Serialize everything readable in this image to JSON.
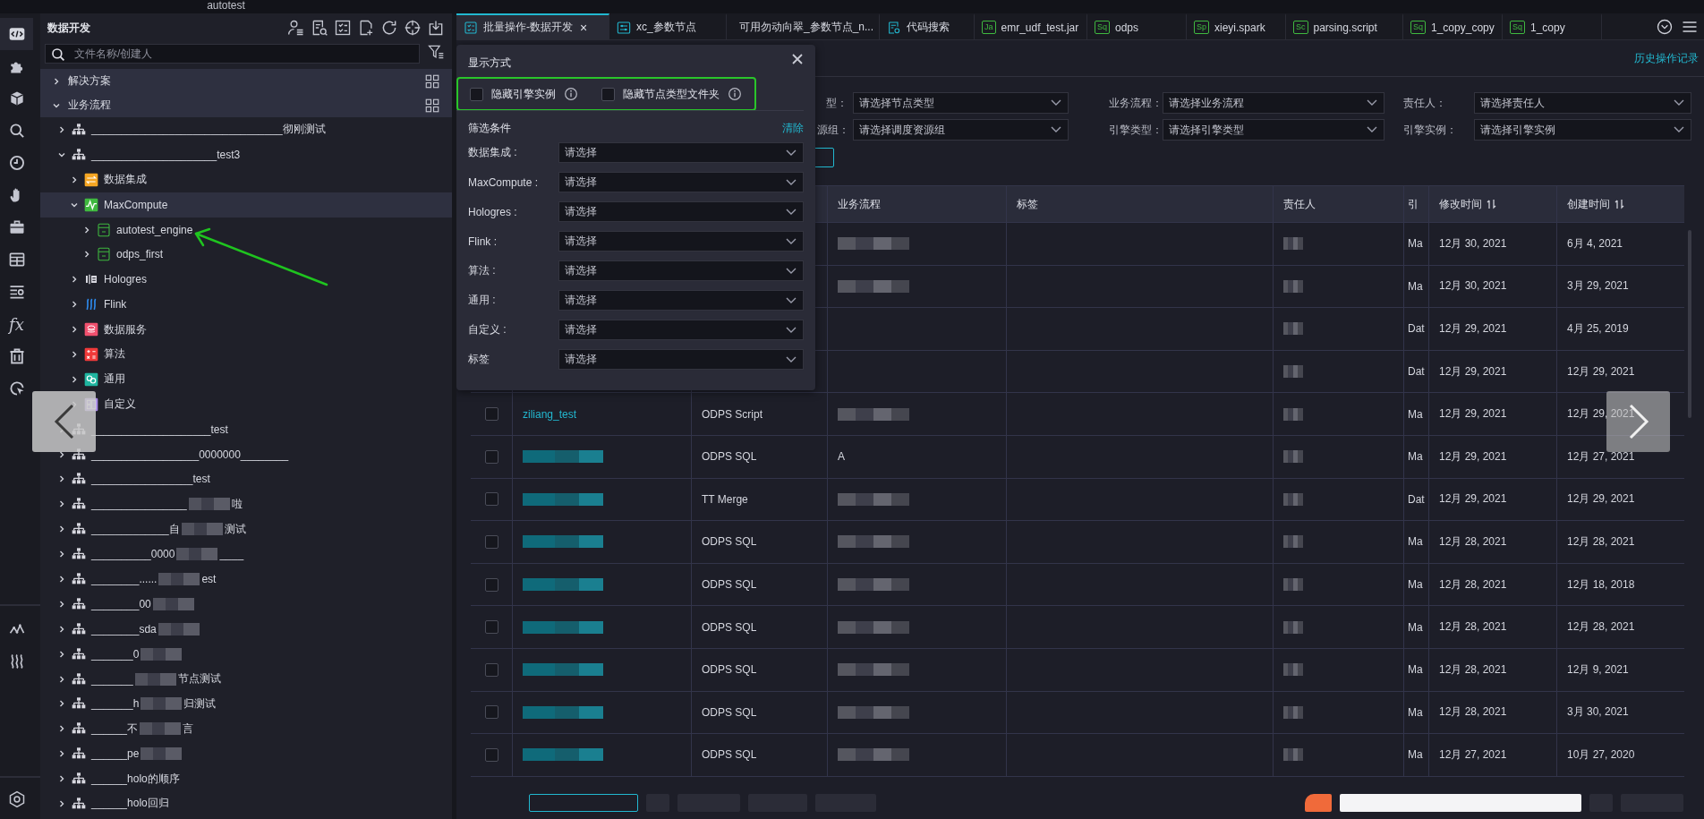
{
  "window": {
    "title": "autotest"
  },
  "rail": {
    "items": [
      {
        "kind": "code",
        "selected": true
      },
      {
        "kind": "puzzle",
        "selected": false
      },
      {
        "kind": "cube",
        "selected": false
      },
      {
        "kind": "search",
        "selected": false
      },
      {
        "kind": "clock",
        "selected": false
      },
      {
        "kind": "hand",
        "selected": false
      },
      {
        "kind": "toolbox",
        "selected": false
      },
      {
        "kind": "table",
        "selected": false
      },
      {
        "kind": "list",
        "selected": false
      },
      {
        "kind": "glyph",
        "text": "fx",
        "selected": false
      },
      {
        "kind": "trash",
        "selected": false
      },
      {
        "kind": "cursor",
        "selected": false
      },
      {
        "kind": "linechart",
        "selected": false
      },
      {
        "kind": "waves",
        "selected": false
      },
      {
        "kind": "settings",
        "selected": false
      }
    ]
  },
  "sidebar": {
    "title": "数据开发",
    "search": {
      "placeholder": "文件名称/创建人"
    },
    "sections": [
      {
        "label": "解决方案",
        "expanded": false
      },
      {
        "label": "业务流程",
        "expanded": true,
        "children": [
          {
            "kind": "workflow",
            "label": "________________________________彻刚测试",
            "expanded": false,
            "selected": false
          },
          {
            "kind": "workflow",
            "label": "_____________________test3",
            "expanded": true,
            "selected": false,
            "children": [
              {
                "kind": "integration",
                "label": "数据集成",
                "expanded": false,
                "selected": false
              },
              {
                "kind": "maxcompute",
                "label": "MaxCompute",
                "expanded": true,
                "selected": true,
                "children": [
                  {
                    "kind": "engine",
                    "label": "autotest_engine",
                    "expanded": false,
                    "selected": false
                  },
                  {
                    "kind": "engine",
                    "label": "odps_first",
                    "expanded": false,
                    "selected": false
                  }
                ]
              },
              {
                "kind": "hologres",
                "label": "Hologres",
                "expanded": false,
                "selected": false
              },
              {
                "kind": "flink",
                "label": "Flink",
                "expanded": false,
                "selected": false
              },
              {
                "kind": "dataservice",
                "label": "数据服务",
                "expanded": false,
                "selected": false
              },
              {
                "kind": "algorithm",
                "label": "算法",
                "expanded": false,
                "selected": false
              },
              {
                "kind": "general",
                "label": "通用",
                "expanded": false,
                "selected": false
              },
              {
                "kind": "custom",
                "label": "自定义",
                "expanded": false,
                "selected": false
              }
            ]
          },
          {
            "kind": "workflow",
            "label": "____________________test",
            "expanded": false,
            "selected": false
          },
          {
            "kind": "workflow",
            "label": "__________________0000000________",
            "expanded": false,
            "selected": false
          },
          {
            "kind": "workflow",
            "label": "_________________test",
            "expanded": false,
            "selected": false
          },
          {
            "kind": "workflow",
            "parts": [
              {
                "text": "________________"
              },
              {
                "kind": "redacted"
              },
              {
                "text": "啦"
              }
            ],
            "expanded": false,
            "selected": false
          },
          {
            "kind": "workflow",
            "parts": [
              {
                "text": "_____________自"
              },
              {
                "kind": "redacted"
              },
              {
                "text": "测试"
              }
            ],
            "expanded": false,
            "selected": false
          },
          {
            "kind": "workflow",
            "parts": [
              {
                "text": "__________0000"
              },
              {
                "kind": "redacted"
              },
              {
                "text": "____"
              }
            ],
            "expanded": false,
            "selected": false
          },
          {
            "kind": "workflow",
            "parts": [
              {
                "text": "________......"
              },
              {
                "kind": "redacted"
              },
              {
                "text": "est"
              }
            ],
            "expanded": false,
            "selected": false
          },
          {
            "kind": "workflow",
            "parts": [
              {
                "text": "________00"
              },
              {
                "kind": "redacted"
              }
            ],
            "expanded": false,
            "selected": false
          },
          {
            "kind": "workflow",
            "parts": [
              {
                "text": "________sda"
              },
              {
                "kind": "redacted"
              }
            ],
            "expanded": false,
            "selected": false
          },
          {
            "kind": "workflow",
            "parts": [
              {
                "text": "_______0"
              },
              {
                "kind": "redacted"
              }
            ],
            "expanded": false,
            "selected": false
          },
          {
            "kind": "workflow",
            "parts": [
              {
                "text": "_______"
              },
              {
                "kind": "redacted"
              },
              {
                "text": "节点测试"
              }
            ],
            "expanded": false,
            "selected": false
          },
          {
            "kind": "workflow",
            "parts": [
              {
                "text": "_______h"
              },
              {
                "kind": "redacted"
              },
              {
                "text": "归测试"
              }
            ],
            "expanded": false,
            "selected": false
          },
          {
            "kind": "workflow",
            "parts": [
              {
                "text": "______不"
              },
              {
                "kind": "redacted"
              },
              {
                "text": "言"
              }
            ],
            "expanded": false,
            "selected": false
          },
          {
            "kind": "workflow",
            "parts": [
              {
                "text": "______pe"
              },
              {
                "kind": "redacted"
              }
            ],
            "expanded": false,
            "selected": false
          },
          {
            "kind": "workflow",
            "label": "______holo的顺序",
            "expanded": false,
            "selected": false
          },
          {
            "kind": "workflow",
            "label": "______holo回归",
            "expanded": false,
            "selected": false
          }
        ]
      }
    ]
  },
  "tabs": [
    {
      "kind": "checklist",
      "label": "批量操作-数据开发",
      "close": "×",
      "selected": true
    },
    {
      "kind": "sliders",
      "label": "xc_参数节点",
      "selected": false
    },
    {
      "kind": "workflow",
      "label": "可用勿动向翠_参数节点_n...",
      "selected": false
    },
    {
      "kind": "codesearch",
      "label": "代码搜索",
      "selected": false
    },
    {
      "kind": "file",
      "badge": "Ja",
      "label": "emr_udf_test.jar",
      "selected": false
    },
    {
      "kind": "file",
      "badge": "Sq",
      "label": "odps",
      "selected": false
    },
    {
      "kind": "file",
      "badge": "Sp",
      "label": "xieyi.spark",
      "selected": false
    },
    {
      "kind": "file",
      "badge": "Sc",
      "label": "parsing.script",
      "selected": false
    },
    {
      "kind": "file",
      "badge": "Sq",
      "label": "1_copy_copy",
      "selected": false
    },
    {
      "kind": "file",
      "badge": "Sq",
      "label": "1_copy",
      "selected": false
    }
  ],
  "history_link": "历史操作记录",
  "filters": [
    {
      "label": "型：",
      "placeholder": "请选择节点类型"
    },
    {
      "label": "业务流程：",
      "placeholder": "请选择业务流程"
    },
    {
      "label": "责任人：",
      "placeholder": "请选择责任人"
    },
    {
      "label": "源组：",
      "placeholder": "请选择调度资源组"
    },
    {
      "label": "引擎类型：",
      "placeholder": "请选择引擎类型"
    },
    {
      "label": "引擎实例：",
      "placeholder": "请选择引擎实例"
    }
  ],
  "table": {
    "columns": [
      {
        "label": "业务流程"
      },
      {
        "label": "标签"
      },
      {
        "label": "责任人"
      },
      {
        "label": "引"
      },
      {
        "label": "修改时间",
        "sortable": true
      },
      {
        "label": "创建时间",
        "sortable": true
      }
    ],
    "rows": [
      {
        "flow": {
          "kind": "redacted"
        },
        "owner": {
          "kind": "redacted"
        },
        "engine": "Ma",
        "modified": "12月 30, 2021",
        "created": "6月 4, 2021"
      },
      {
        "flow": {
          "kind": "redacted"
        },
        "owner": {
          "kind": "redacted"
        },
        "engine": "Ma",
        "modified": "12月 30, 2021",
        "created": "3月 29, 2021"
      },
      {
        "owner": {
          "kind": "redacted"
        },
        "engine": "Dat",
        "modified": "12月 29, 2021",
        "created": "4月 25, 2019"
      },
      {
        "owner": {
          "kind": "redacted"
        },
        "engine": "Dat",
        "modified": "12月 29, 2021",
        "created": "12月 29, 2021"
      },
      {
        "checked": false,
        "name": "ziliang_test",
        "type": "ODPS Script",
        "flow": {
          "kind": "redacted"
        },
        "owner": {
          "kind": "redacted"
        },
        "engine": "Ma",
        "modified": "12月 29, 2021",
        "created": "12月 29, 2021"
      },
      {
        "checked": false,
        "name": {
          "kind": "redacted"
        },
        "type": "ODPS SQL",
        "flow": "A",
        "owner": {
          "kind": "redacted"
        },
        "engine": "Ma",
        "modified": "12月 29, 2021",
        "created": "12月 27, 2021"
      },
      {
        "checked": false,
        "name": {
          "kind": "redacted"
        },
        "type": "TT Merge",
        "flow": {
          "kind": "redacted"
        },
        "owner": {
          "kind": "redacted"
        },
        "engine": "Dat",
        "modified": "12月 29, 2021",
        "created": "12月 29, 2021"
      },
      {
        "checked": false,
        "name": {
          "kind": "redacted"
        },
        "type": "ODPS SQL",
        "flow": {
          "kind": "redacted"
        },
        "owner": {
          "kind": "redacted"
        },
        "engine": "Ma",
        "modified": "12月 28, 2021",
        "created": "12月 28, 2021"
      },
      {
        "checked": false,
        "name": {
          "kind": "redacted"
        },
        "type": "ODPS SQL",
        "flow": {
          "kind": "redacted"
        },
        "owner": {
          "kind": "redacted"
        },
        "engine": "Ma",
        "modified": "12月 28, 2021",
        "created": "12月 18, 2018"
      },
      {
        "checked": false,
        "name": {
          "kind": "redacted"
        },
        "type": "ODPS SQL",
        "flow": {
          "kind": "redacted"
        },
        "owner": {
          "kind": "redacted"
        },
        "engine": "Ma",
        "modified": "12月 28, 2021",
        "created": "12月 28, 2021"
      },
      {
        "checked": false,
        "name": {
          "kind": "redacted"
        },
        "type": "ODPS SQL",
        "flow": {
          "kind": "redacted"
        },
        "owner": {
          "kind": "redacted"
        },
        "engine": "Ma",
        "modified": "12月 28, 2021",
        "created": "12月 9, 2021"
      },
      {
        "checked": false,
        "name": {
          "kind": "redacted"
        },
        "type": "ODPS SQL",
        "flow": {
          "kind": "redacted"
        },
        "owner": {
          "kind": "redacted"
        },
        "engine": "Ma",
        "modified": "12月 28, 2021",
        "created": "3月 30, 2021"
      },
      {
        "checked": false,
        "name": {
          "kind": "redacted"
        },
        "type": "ODPS SQL",
        "flow": {
          "kind": "redacted"
        },
        "owner": {
          "kind": "redacted"
        },
        "engine": "Ma",
        "modified": "12月 27, 2021",
        "created": "10月 27, 2020"
      }
    ]
  },
  "popup": {
    "title": "显示方式",
    "options": [
      {
        "label": "隐藏引擎实例",
        "checked": false
      },
      {
        "label": "隐藏节点类型文件夹",
        "checked": false
      }
    ],
    "filter_title": "筛选条件",
    "clear": "清除",
    "filters": [
      {
        "label": "数据集成 :",
        "placeholder": "请选择"
      },
      {
        "label": "MaxCompute :",
        "placeholder": "请选择"
      },
      {
        "label": "Hologres :",
        "placeholder": "请选择"
      },
      {
        "label": "Flink :",
        "placeholder": "请选择"
      },
      {
        "label": "算法 :",
        "placeholder": "请选择"
      },
      {
        "label": "通用 :",
        "placeholder": "请选择"
      },
      {
        "label": "自定义 :",
        "placeholder": "请选择"
      },
      {
        "label": "标签",
        "placeholder": "请选择"
      }
    ]
  }
}
